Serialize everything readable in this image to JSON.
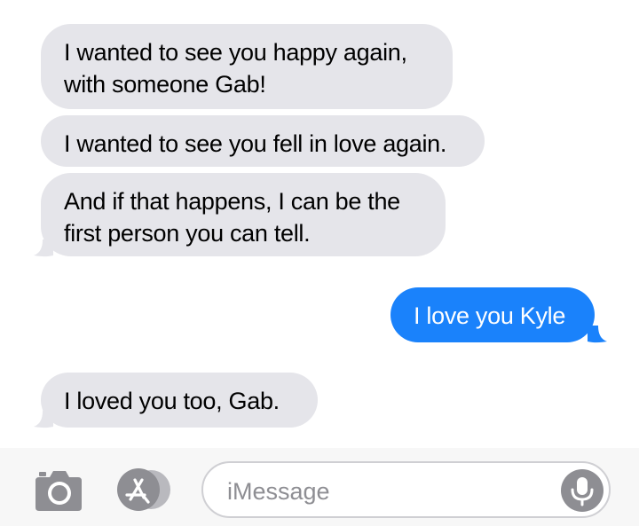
{
  "messages": [
    {
      "direction": "incoming",
      "lines": [
        "I wanted to see you happy again,",
        "with someone Gab!"
      ]
    },
    {
      "direction": "incoming",
      "lines": [
        "I wanted to see you fell in love again."
      ]
    },
    {
      "direction": "incoming",
      "lines": [
        "And if that happens, I can be the",
        "first person you can tell."
      ]
    },
    {
      "direction": "outgoing",
      "lines": [
        "I love you Kyle"
      ]
    },
    {
      "direction": "incoming",
      "lines": [
        "I loved you too, Gab."
      ]
    }
  ],
  "input_bar": {
    "camera_icon": "camera-icon",
    "apps_icon": "app-store-icon",
    "placeholder": "iMessage",
    "mic_icon": "microphone-icon"
  },
  "colors": {
    "incoming_bubble": "#e5e5ea",
    "outgoing_bubble": "#1a82fb",
    "icon_gray": "#8e8e93"
  }
}
